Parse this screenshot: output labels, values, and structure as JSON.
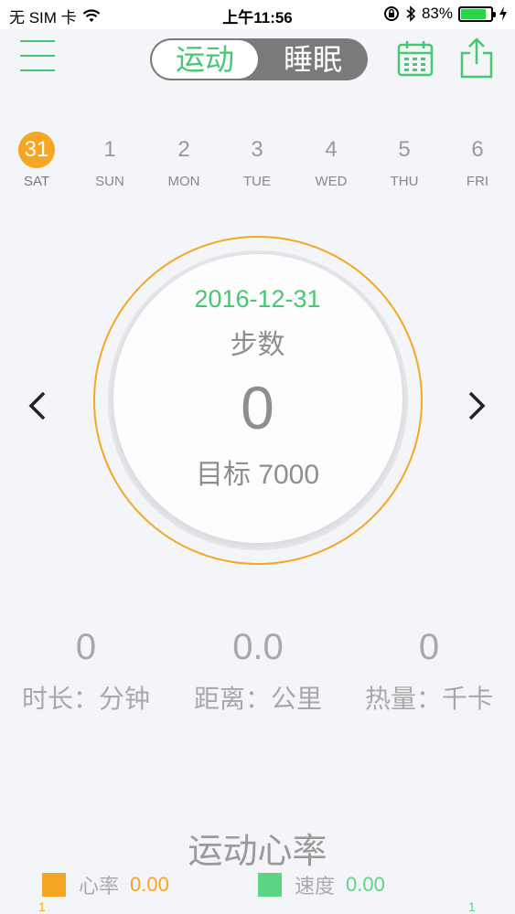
{
  "status_bar": {
    "carrier": "无 SIM 卡",
    "time": "上午11:56",
    "battery": "83%",
    "battery_level": 0.83
  },
  "nav": {
    "tabs": [
      {
        "label": "运动",
        "active": true
      },
      {
        "label": "睡眠",
        "active": false
      }
    ],
    "icons": [
      "menu-icon",
      "calendar-icon",
      "share-icon"
    ]
  },
  "week": [
    {
      "num": "31",
      "wd": "SAT",
      "active": true
    },
    {
      "num": "1",
      "wd": "SUN",
      "active": false
    },
    {
      "num": "2",
      "wd": "MON",
      "active": false
    },
    {
      "num": "3",
      "wd": "TUE",
      "active": false
    },
    {
      "num": "4",
      "wd": "WED",
      "active": false
    },
    {
      "num": "5",
      "wd": "THU",
      "active": false
    },
    {
      "num": "6",
      "wd": "FRI",
      "active": false
    }
  ],
  "summary": {
    "date": "2016-12-31",
    "label": "步数",
    "steps": "0",
    "goal": "目标 7000"
  },
  "stats": [
    {
      "value": "0",
      "label": "时长：分钟"
    },
    {
      "value": "0.0",
      "label": "距离：公里"
    },
    {
      "value": "0",
      "label": "热量：千卡"
    }
  ],
  "heart": {
    "title": "运动心率",
    "legend": [
      {
        "name": "心率",
        "value": "0.00",
        "color": "#f5a623"
      },
      {
        "name": "速度",
        "value": "0.00",
        "color": "#5bd583"
      }
    ],
    "tick_left": "1",
    "tick_right": "1"
  },
  "colors": {
    "accent_green": "#46c772",
    "accent_orange": "#f5a623"
  }
}
